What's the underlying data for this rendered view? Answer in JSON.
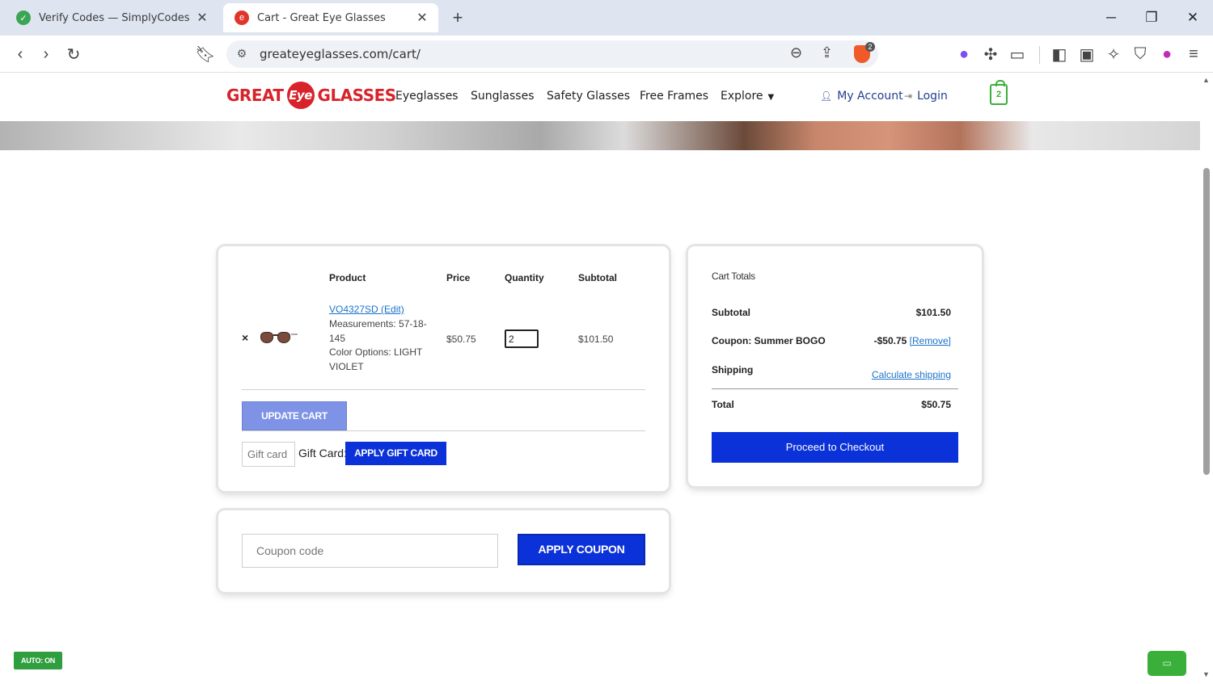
{
  "browser": {
    "tabs": [
      {
        "title": "Verify Codes — SimplyCodes",
        "active": false
      },
      {
        "title": "Cart - Great Eye Glasses",
        "active": true
      }
    ],
    "new_tab_label": "+",
    "url": "greateyeglasses.com/cart/",
    "brave_badge": "2",
    "icons": {
      "back": "back-arrow-icon",
      "forward": "forward-arrow-icon",
      "reload": "reload-icon",
      "bookmark": "bookmark-icon",
      "site_settings": "site-settings-icon",
      "zoom": "zoom-out-icon",
      "share": "share-icon",
      "brave_shields": "brave-shields-icon"
    }
  },
  "site": {
    "logo": {
      "left": "GREAT",
      "eye": "Eye",
      "right": "GLASSES"
    },
    "nav": [
      "Eyeglasses",
      "Sunglasses",
      "Safety Glasses",
      "Free Frames",
      "Explore"
    ],
    "account_label": "My Account",
    "login_label": "Login",
    "cart_count": "2",
    "brand_color": "#d8232a",
    "accent_color": "#0b31d8"
  },
  "cart": {
    "headers": {
      "product": "Product",
      "price": "Price",
      "quantity": "Quantity",
      "subtotal": "Subtotal"
    },
    "item": {
      "remove_label": "×",
      "name": "VO4327SD (Edit)",
      "measurements": "Measurements: 57-18-145",
      "color_options": "Color Options: LIGHT VIOLET",
      "price": "$50.75",
      "quantity": "2",
      "subtotal": "$101.50"
    },
    "update_button": "UPDATE CART",
    "gift_card_placeholder": "Gift card",
    "gift_card_label": "Gift Card:",
    "gift_card_button": "APPLY GIFT CARD"
  },
  "totals": {
    "title": "Cart Totals",
    "subtotal_label": "Subtotal",
    "subtotal_value": "$101.50",
    "coupon_label": "Coupon: Summer BOGO",
    "coupon_value": "-$50.75",
    "coupon_remove": "[Remove]",
    "shipping_label": "Shipping",
    "shipping_link": "Calculate shipping",
    "total_label": "Total",
    "total_value": "$50.75",
    "checkout_button": "Proceed to Checkout"
  },
  "coupon": {
    "placeholder": "Coupon code",
    "button": "APPLY COUPON"
  },
  "overlay": {
    "auto_badge": "AUTO: ON"
  }
}
